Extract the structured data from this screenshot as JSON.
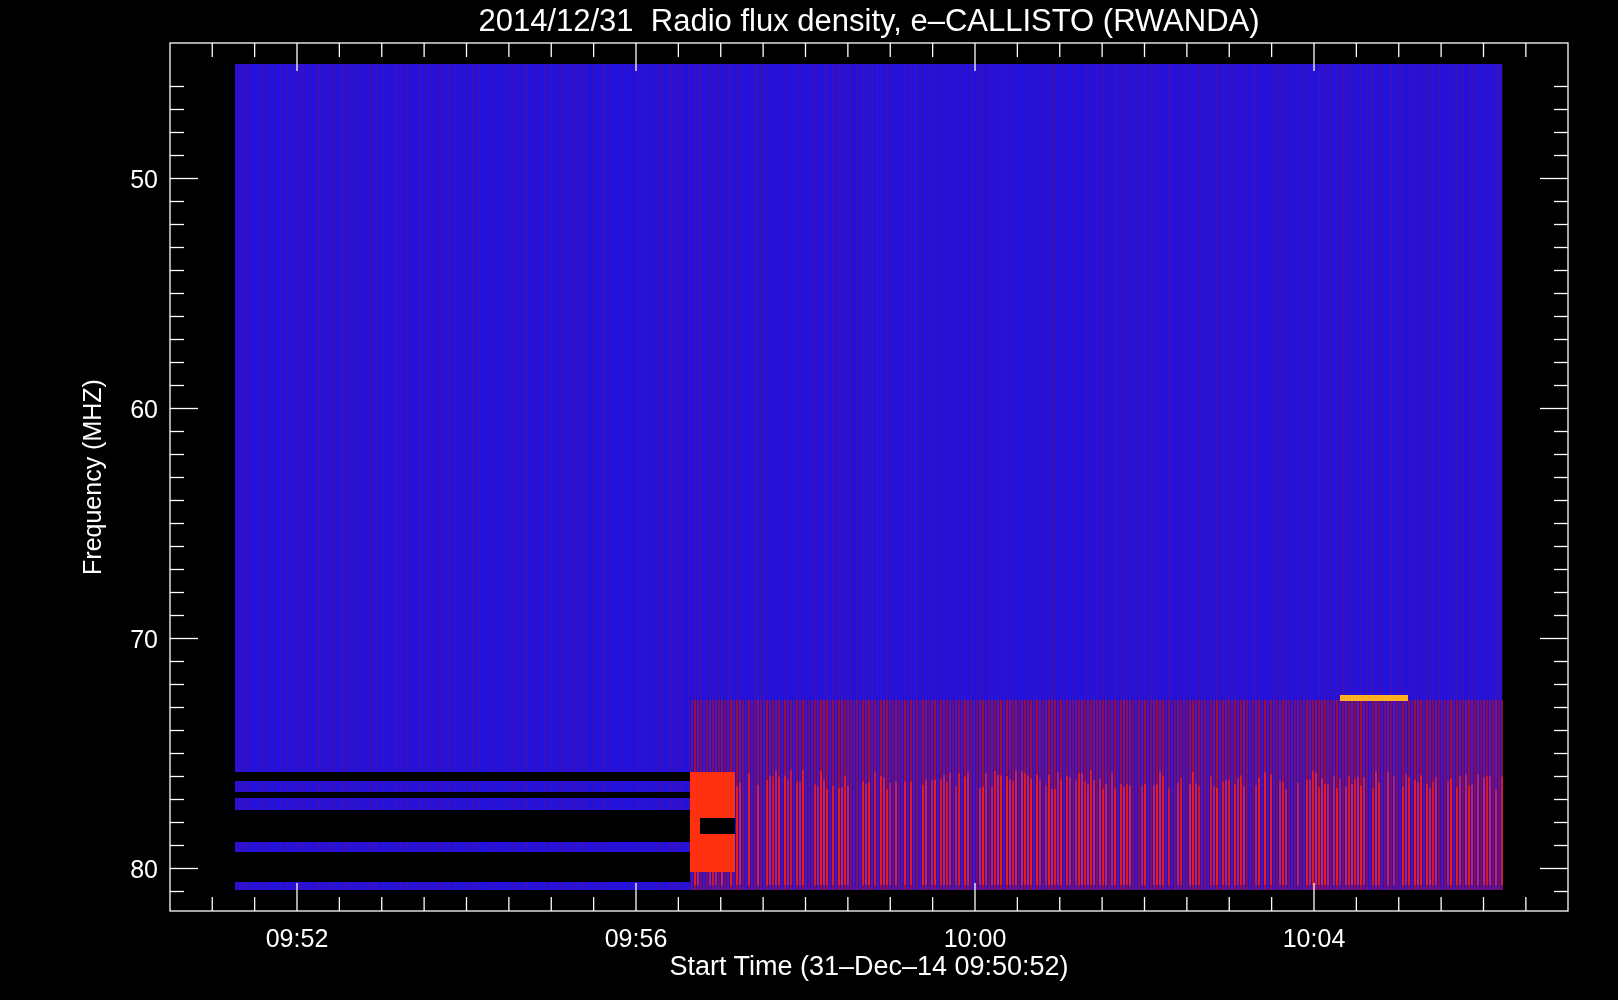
{
  "title": "2014/12/31  Radio flux density, e–CALLISTO (RWANDA)",
  "plot": {
    "ylabel": "Frequency (MHZ)",
    "xlabel": "Start Time (31–Dec–14 09:50:52)",
    "yticks": [
      "50",
      "60",
      "70",
      "80"
    ],
    "xticks": [
      "09:52",
      "09:56",
      "10:00",
      "10:04"
    ]
  }
}
